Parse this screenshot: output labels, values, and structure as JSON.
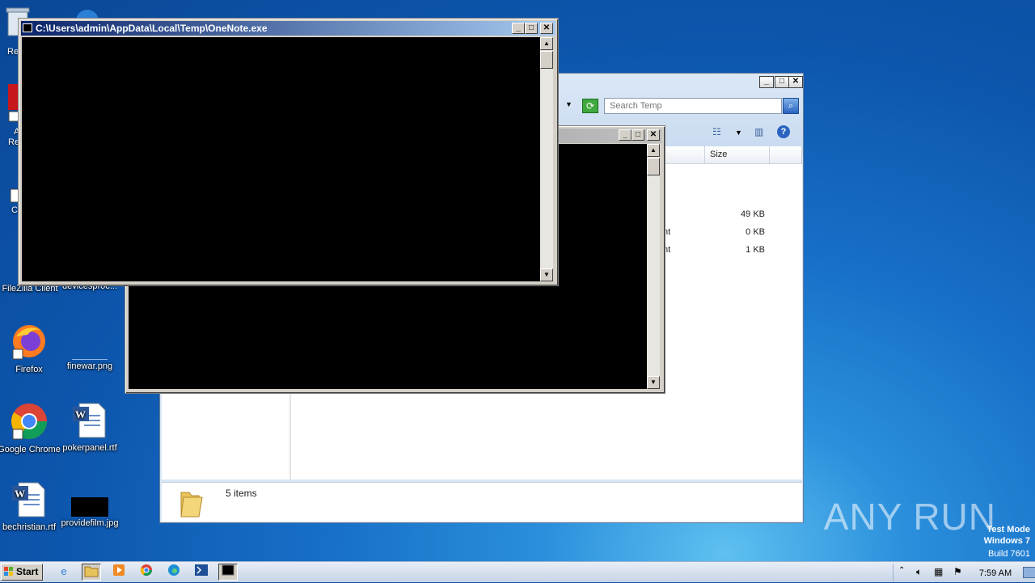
{
  "desktop": {
    "icons": [
      {
        "label": "FileZilla Client"
      },
      {
        "label": "devicesproc..."
      },
      {
        "label": "Firefox"
      },
      {
        "label": "finewar.png"
      },
      {
        "label": "Google Chrome"
      },
      {
        "label": "pokerpanel.rtf"
      },
      {
        "label": "bechristian.rtf"
      },
      {
        "label": "providefilm.jpg"
      }
    ],
    "partial_labels": [
      "Re",
      "A",
      "Re",
      "C"
    ]
  },
  "console_main": {
    "title": "C:\\Users\\admin\\AppData\\Local\\Temp\\OneNote.exe"
  },
  "console_back": {
    "title": ""
  },
  "explorer": {
    "search_placeholder": "Search Temp",
    "columns": {
      "size": "Size"
    },
    "rows": [
      {
        "type": "",
        "size": "49 KB"
      },
      {
        "type": "nt",
        "size": "0 KB"
      },
      {
        "type": "nt",
        "size": "1 KB"
      }
    ],
    "status": "5 items"
  },
  "taskbar": {
    "start_label": "Start",
    "clock": "7:59 AM"
  },
  "watermark": {
    "text": "ANY RUN",
    "test_mode": "Test Mode",
    "os": "Windows 7",
    "build": "Build 7601"
  },
  "colors": {
    "desktop": "#1870c8",
    "titlebar_active": "#0a246a",
    "console_bg": "#000000"
  }
}
